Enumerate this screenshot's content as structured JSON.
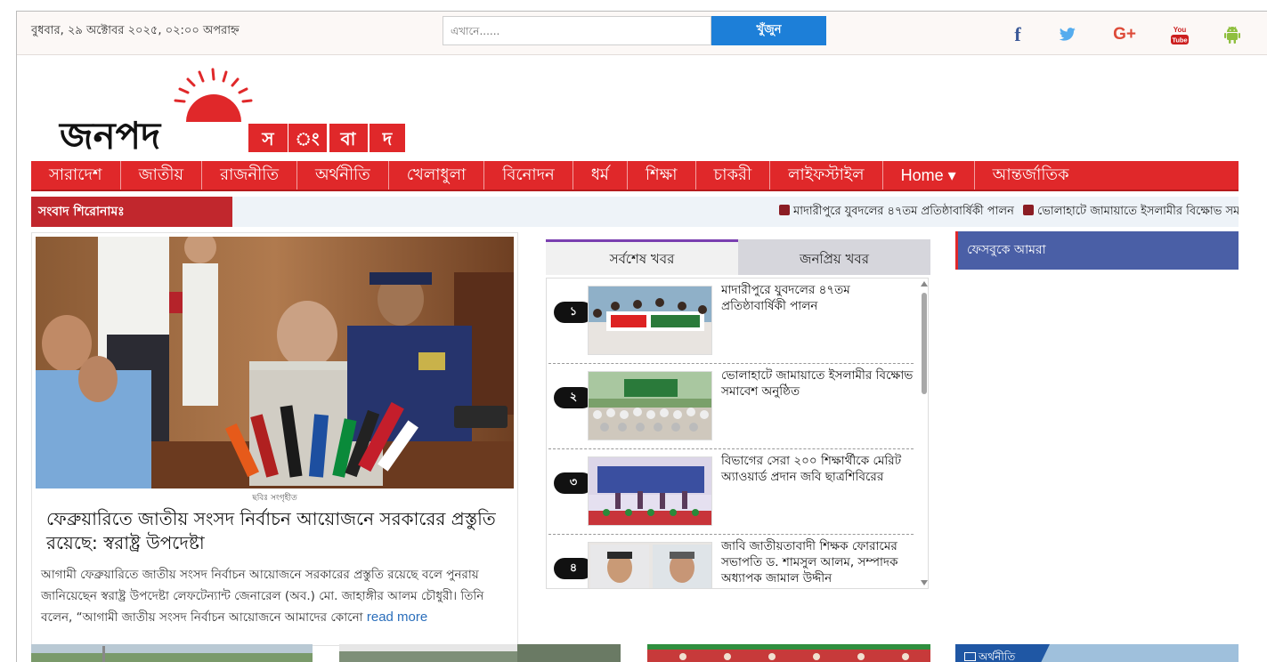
{
  "topbar": {
    "date": "বুধবার, ২৯ অক্টোবর ২০২৫, ০২:০০ অপরাহ্ন",
    "search_placeholder": "এখানে......",
    "search_button": "খুঁজুন",
    "social": [
      "facebook-icon",
      "twitter-icon",
      "google-plus-icon",
      "youtube-icon",
      "android-icon"
    ],
    "facebook_glyph": "f",
    "gplus_glyph": "G+",
    "youtube_top": "You",
    "youtube_bottom": "Tube"
  },
  "logo": {
    "part1": "জনপদ",
    "part2": [
      "স",
      "ং",
      "বা",
      "দ"
    ]
  },
  "nav": {
    "items": [
      "সারাদেশ",
      "জাতীয়",
      "রাজনীতি",
      "অর্থনীতি",
      "খেলাধুলা",
      "বিনোদন",
      "ধর্ম",
      "শিক্ষা",
      "চাকরী",
      "লাইফস্টাইল",
      "Home ▾",
      "আন্তর্জাতিক"
    ]
  },
  "ticker": {
    "label": "সংবাদ শিরোনামঃ",
    "items": [
      "মাদারীপুরে যুবদলের ৪৭তম প্রতিষ্ঠাবার্ষিকী পালন",
      "ভোলাহাটে জামায়াতে ইসলামীর বিক্ষোভ সমাবেশ অনুষ্ঠিত"
    ]
  },
  "lead": {
    "caption": "ছবিঃ সংগৃহীত",
    "title": "ফেব্রুয়ারিতে জাতীয় সংসদ নির্বাচন আয়োজনে সরকারের প্রস্তুতি রয়েছে: স্বরাষ্ট্র উপদেষ্টা",
    "body": "আগামী ফেব্রুয়ারিতে জাতীয় সংসদ নির্বাচন আয়োজনে সরকারের প্রস্তুতি রয়েছে বলে পুনরায় জানিয়েছেন স্বরাষ্ট্র উপদেষ্টা লেফটেন্যান্ট জেনারেল (অব.) মো. জাহাঙ্গীর আলম চৌধুরী। তিনি বলেন, “আগামী জাতীয় সংসদ নির্বাচন আয়োজনে আমাদের কোনো",
    "read_more": "read more"
  },
  "tabs": {
    "latest": "সর্বশেষ খবর",
    "popular": "জনপ্রিয় খবর"
  },
  "latest_news": [
    {
      "num": "১",
      "title": "মাদারীপুরে যুবদলের ৪৭তম প্রতিষ্ঠাবার্ষিকী পালন"
    },
    {
      "num": "২",
      "title": "ভোলাহাটে জামায়াতে ইসলামীর বিক্ষোভ সমাবেশ অনুষ্ঠিত"
    },
    {
      "num": "৩",
      "title": "বিভাগের সেরা ২০০ শিক্ষার্থীকে মেরিট অ্যাওয়ার্ড প্রদান জবি ছাত্রশিবিরের"
    },
    {
      "num": "৪",
      "title": "জাবি জাতীয়তাবাদী শিক্ষক ফোরামের সভাপতি ড. শামসুল আলম, সম্পাদক অধ্যাপক জামাল উদ্দীন"
    }
  ],
  "sidebar": {
    "facebook_title": "ফেসবুকে আমরা"
  },
  "bottom": {
    "category_label": "অর্থনীতি"
  },
  "colors": {
    "nav_red": "#e0282a",
    "ticker_label": "#c1272d",
    "search_blue": "#1d7fd8",
    "tab_accent": "#7a3fb0",
    "fb_blue": "#4a5fa6"
  }
}
